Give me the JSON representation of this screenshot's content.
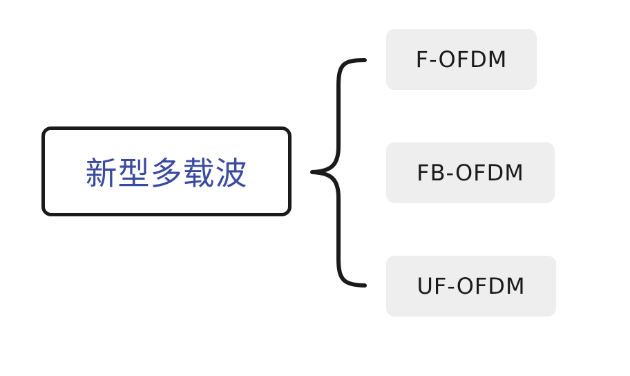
{
  "root": {
    "label": "新型多载波",
    "text_color": "#3a4aa0",
    "border_color": "#1a1a1a"
  },
  "children": [
    {
      "label": "F-OFDM"
    },
    {
      "label": "FB-OFDM"
    },
    {
      "label": "UF-OFDM"
    }
  ],
  "colors": {
    "leaf_background": "#eeeeee",
    "leaf_text": "#1a1a1a",
    "connector": "#1a1a1a"
  }
}
